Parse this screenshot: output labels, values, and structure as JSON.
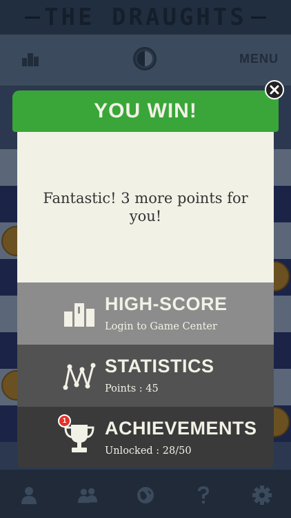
{
  "app": {
    "title": "THE DRAUGHTS"
  },
  "toolbar": {
    "menu_label": "MENU"
  },
  "dialog": {
    "title": "YOU WIN!",
    "message": "Fantastic! 3 more points for you!",
    "panels": [
      {
        "title": "HIGH-SCORE",
        "subtitle": "Login to Game Center",
        "icon": "podium-icon"
      },
      {
        "title": "STATISTICS",
        "subtitle": "Points : 45",
        "icon": "line-graph-icon"
      },
      {
        "title": "ACHIEVEMENTS",
        "subtitle": "Unlocked : 28/50",
        "icon": "trophy-icon",
        "badge": "1"
      }
    ]
  },
  "bottom_bar": {
    "items": [
      "single-player-icon",
      "two-players-icon",
      "online-globe-icon",
      "help-icon",
      "settings-gear-icon"
    ]
  },
  "colors": {
    "win_green": "#3aa639",
    "panel_light": "#8c8c8c",
    "panel_mid": "#525252",
    "panel_dark": "#3a3a3a",
    "badge_red": "#e5312b"
  }
}
